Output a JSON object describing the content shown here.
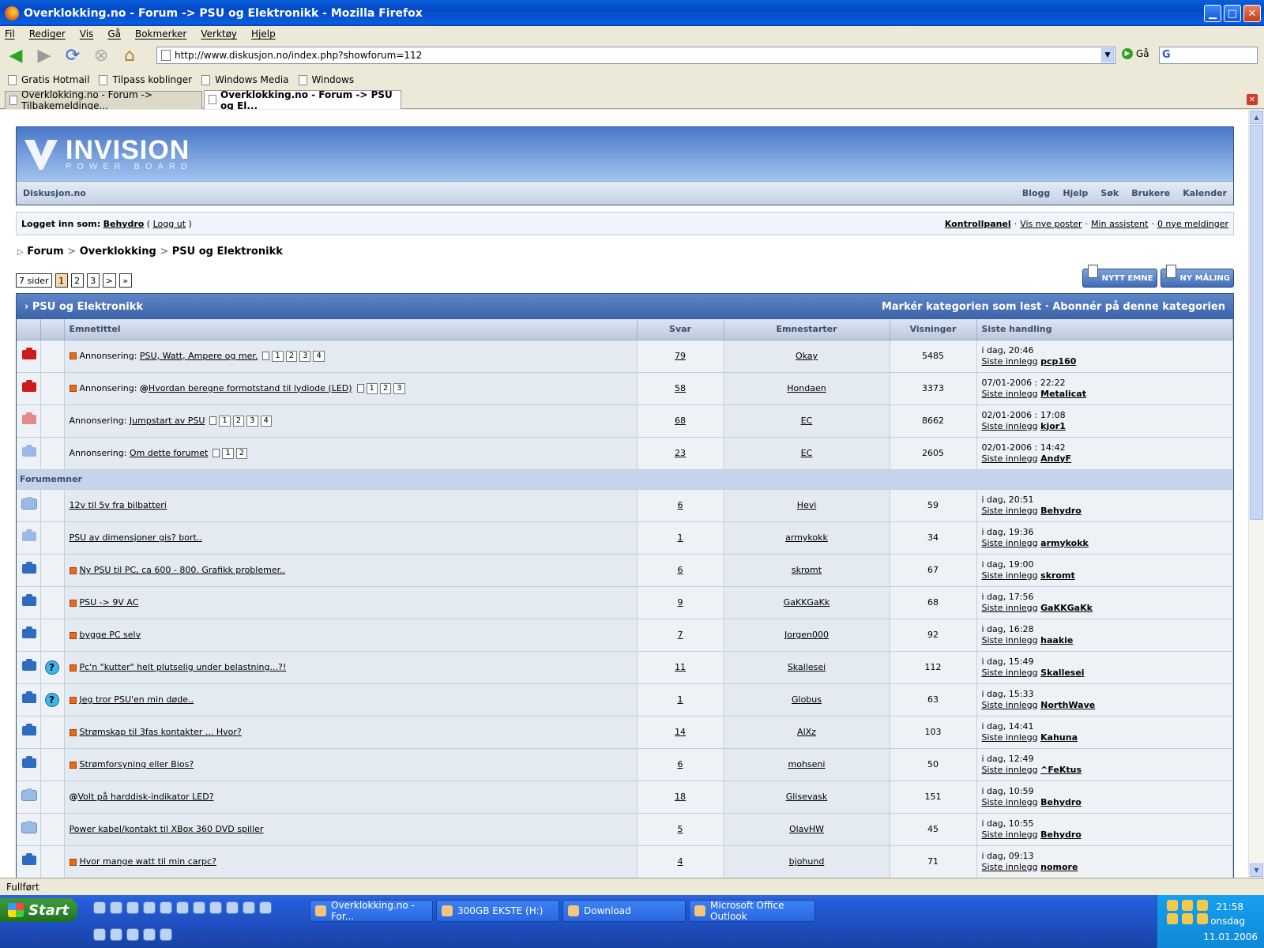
{
  "window": {
    "title": "Overklokking.no - Forum -> PSU og Elektronikk - Mozilla Firefox"
  },
  "menu": [
    "Fil",
    "Rediger",
    "Vis",
    "Gå",
    "Bokmerker",
    "Verktøy",
    "Hjelp"
  ],
  "toolbar": {
    "url": "http://www.diskusjon.no/index.php?showforum=112",
    "go_label": "Gå"
  },
  "bookmarks": [
    "Gratis Hotmail",
    "Tilpass koblinger",
    "Windows Media",
    "Windows"
  ],
  "tabs": [
    {
      "label": "Overklokking.no - Forum -> Tilbakemeldinge..."
    },
    {
      "label": "Overklokking.no - Forum -> PSU og El..."
    }
  ],
  "board": {
    "logo_name": "INVISION",
    "logo_sub": "POWER BOARD",
    "site": "Diskusjon.no",
    "nav_links": [
      "Blogg",
      "Hjelp",
      "Søk",
      "Brukere",
      "Kalender"
    ]
  },
  "userbar": {
    "logged_in_label": "Logget inn som:",
    "username": "Behydro",
    "logout": "Logg ut",
    "links": [
      "Kontrollpanel",
      "Vis nye poster",
      "Min assistent",
      "0 nye meldinger"
    ]
  },
  "breadcrumb": [
    "Forum",
    "Overklokking",
    "PSU og Elektronikk"
  ],
  "pager": {
    "pages_label": "7 sider",
    "items": [
      "1",
      "2",
      "3",
      ">",
      "»"
    ]
  },
  "actions": {
    "new_topic": "NYTT EMNE",
    "new_poll": "NY MÅLING"
  },
  "forum": {
    "title": "PSU og Elektronikk",
    "header_links": "Markér kategorien som lest · Abonnér på denne kategorien",
    "columns": [
      "Emnetittel",
      "Svar",
      "Emnestarter",
      "Visninger",
      "Siste handling"
    ],
    "section_label": "Forumemner",
    "last_post_label": "Siste innlegg"
  },
  "announcements": [
    {
      "folder": "red",
      "prefix": "Annonsering:",
      "title": "PSU, Watt, Ampere og mer.",
      "new": true,
      "attach": false,
      "pages": [
        "1",
        "2",
        "3",
        "4"
      ],
      "replies": "79",
      "starter": "Okay",
      "views": "5485",
      "last_date": "i dag, 20:46",
      "last_user": "pcp160"
    },
    {
      "folder": "red",
      "prefix": "Annonsering:",
      "title": "Hvordan beregne formotstand til lydiode (LED)",
      "new": true,
      "attach": true,
      "pages": [
        "1",
        "2",
        "3"
      ],
      "replies": "58",
      "starter": "Hondaen",
      "views": "3373",
      "last_date": "07/01-2006 : 22:22",
      "last_user": "Metalicat"
    },
    {
      "folder": "pink",
      "prefix": "Annonsering:",
      "title": "Jumpstart av PSU",
      "new": false,
      "attach": false,
      "pages": [
        "1",
        "2",
        "3",
        "4"
      ],
      "replies": "68",
      "starter": "EC",
      "views": "8662",
      "last_date": "02/01-2006 : 17:08",
      "last_user": "kjor1"
    },
    {
      "folder": "lblue",
      "prefix": "Annonsering:",
      "title": "Om dette forumet",
      "new": false,
      "attach": false,
      "pages": [
        "1",
        "2"
      ],
      "replies": "23",
      "starter": "EC",
      "views": "2605",
      "last_date": "02/01-2006 : 14:42",
      "last_user": "AndyF"
    }
  ],
  "topics": [
    {
      "folder": "hot",
      "q": false,
      "new": false,
      "attach": false,
      "title": "12v til 5v fra bilbatteri",
      "replies": "6",
      "starter": "Hevi",
      "views": "59",
      "last_date": "i dag, 20:51",
      "last_user": "Behydro"
    },
    {
      "folder": "lblue",
      "q": false,
      "new": false,
      "attach": false,
      "title": "PSU av dimensjoner gis? bort..",
      "replies": "1",
      "starter": "armykokk",
      "views": "34",
      "last_date": "i dag, 19:36",
      "last_user": "armykokk"
    },
    {
      "folder": "blue",
      "q": false,
      "new": true,
      "attach": false,
      "title": "Ny PSU til PC, ca 600 - 800. Grafikk problemer..",
      "replies": "6",
      "starter": "skromt",
      "views": "67",
      "last_date": "i dag, 19:00",
      "last_user": "skromt"
    },
    {
      "folder": "blue",
      "q": false,
      "new": true,
      "attach": false,
      "title": "PSU -> 9V AC",
      "replies": "9",
      "starter": "GaKKGaKk",
      "views": "68",
      "last_date": "i dag, 17:56",
      "last_user": "GaKKGaKk"
    },
    {
      "folder": "blue",
      "q": false,
      "new": true,
      "attach": false,
      "title": "bygge PC selv",
      "replies": "7",
      "starter": "Jorgen000",
      "views": "92",
      "last_date": "i dag, 16:28",
      "last_user": "haakie"
    },
    {
      "folder": "blue",
      "q": true,
      "new": true,
      "attach": false,
      "title": "Pc'n \"kutter\" helt plutselig under belastning...?!",
      "replies": "11",
      "starter": "Skallesei",
      "views": "112",
      "last_date": "i dag, 15:49",
      "last_user": "Skallesei"
    },
    {
      "folder": "blue",
      "q": true,
      "new": true,
      "attach": false,
      "title": "Jeg tror PSU'en min døde..",
      "replies": "1",
      "starter": "Globus",
      "views": "63",
      "last_date": "i dag, 15:33",
      "last_user": "NorthWave"
    },
    {
      "folder": "blue",
      "q": false,
      "new": true,
      "attach": false,
      "title": "Strømskap til 3fas kontakter ... Hvor?",
      "replies": "14",
      "starter": "AlXz",
      "views": "103",
      "last_date": "i dag, 14:41",
      "last_user": "Kahuna"
    },
    {
      "folder": "blue",
      "q": false,
      "new": true,
      "attach": false,
      "title": "Strømforsyning eller Bios?",
      "replies": "6",
      "starter": "mohseni",
      "views": "50",
      "last_date": "i dag, 12:49",
      "last_user": "^FeKtus"
    },
    {
      "folder": "hot",
      "q": false,
      "new": false,
      "attach": true,
      "title": "Volt på harddisk-indikator LED?",
      "replies": "18",
      "starter": "Glisevask",
      "views": "151",
      "last_date": "i dag, 10:59",
      "last_user": "Behydro"
    },
    {
      "folder": "hot",
      "q": false,
      "new": false,
      "attach": false,
      "title": "Power kabel/kontakt til XBox 360 DVD spiller",
      "replies": "5",
      "starter": "OlavHW",
      "views": "45",
      "last_date": "i dag, 10:55",
      "last_user": "Behydro"
    },
    {
      "folder": "blue",
      "q": false,
      "new": true,
      "attach": false,
      "title": "Hvor mange watt til min carpc?",
      "replies": "4",
      "starter": "bjohund",
      "views": "71",
      "last_date": "i dag, 09:13",
      "last_user": "nomore"
    }
  ],
  "status": "Fullført",
  "taskbar": {
    "start": "Start",
    "items": [
      "Overklokking.no - For...",
      "300GB EKSTE (H:)",
      "Download",
      "Microsoft Office Outlook"
    ],
    "time": "21:58",
    "day": "onsdag",
    "date": "11.01.2006"
  }
}
